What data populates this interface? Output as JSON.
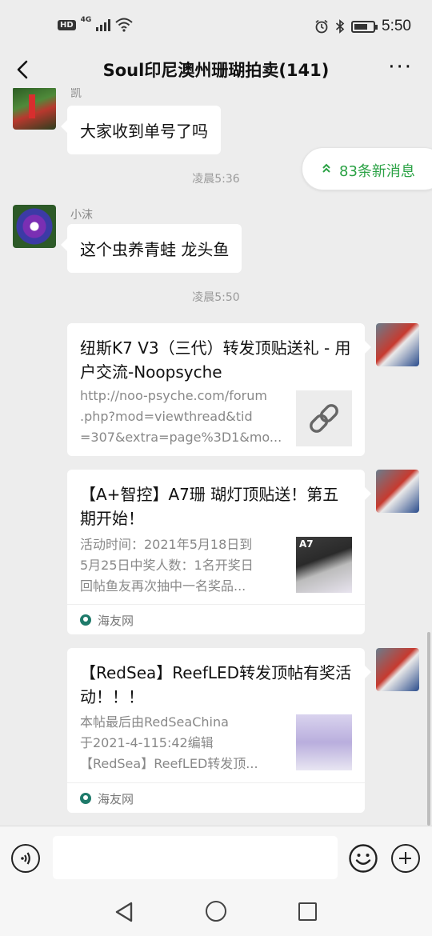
{
  "status_bar": {
    "hd": "HD",
    "network": "4G",
    "time": "5:50"
  },
  "header": {
    "title": "Soul印尼澳州珊瑚拍卖(141)",
    "back_icon": "back-arrow-icon",
    "more_icon": "more-dots-icon",
    "more_label": "···"
  },
  "new_messages": {
    "label": "83条新消息",
    "icon": "double-chevron-up-icon",
    "color": "#2ba245"
  },
  "messages": [
    {
      "type": "text",
      "sender": "凯",
      "text": "大家收到单号了吗"
    },
    {
      "type": "timestamp",
      "text": "凌晨5:36"
    },
    {
      "type": "text",
      "sender": "小沫",
      "text": "这个虫养青蛙  龙头鱼"
    },
    {
      "type": "timestamp",
      "text": "凌晨5:50"
    }
  ],
  "cards": [
    {
      "title": "纽斯K7 V3（三代）转发顶贴送礼 - 用户交流-Noopsyche",
      "desc_lines": [
        "http://noo-psyche.com/forum",
        ".php?mod=viewthread&tid",
        "=307&extra=page%3D1&mo..."
      ],
      "thumb_icon": "link-icon"
    },
    {
      "title": "【A+智控】A7珊 瑚灯顶贴送！第五期开始！",
      "desc_lines": [
        "活动时间：2021年5月18日到",
        "5月25日中奖人数：1名开奖日",
        "回帖鱼友再次抽中一名奖品..."
      ],
      "thumb_label": "A7",
      "source": "海友网"
    },
    {
      "title": "【RedSea】ReefLED转发顶帖有奖活动！！！",
      "desc_lines": [
        "本帖最后由RedSeaChina",
        "于2021-4-115:42编辑",
        "【RedSea】ReefLED转发顶..."
      ],
      "source": "海友网"
    }
  ],
  "input_bar": {
    "voice_icon": "voice-icon",
    "emoji_icon": "emoji-icon",
    "plus_icon": "plus-icon",
    "placeholder": ""
  },
  "nav_bar": {
    "back_icon": "nav-back-icon",
    "home_icon": "nav-home-icon",
    "recent_icon": "nav-recent-icon"
  }
}
